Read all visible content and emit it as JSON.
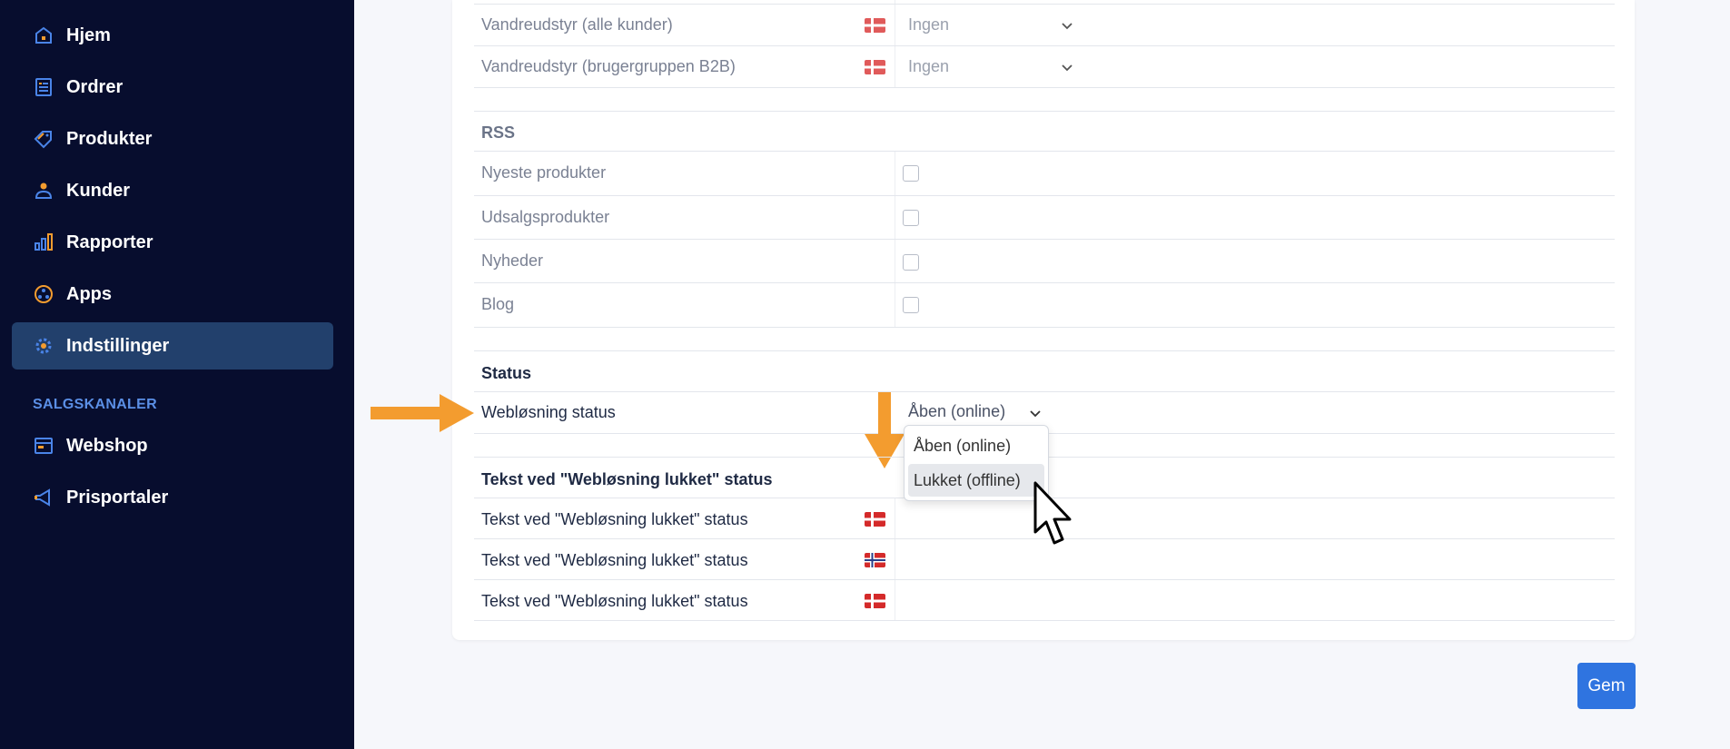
{
  "sidebar": {
    "items": [
      {
        "label": "Hjem",
        "icon": "home-icon"
      },
      {
        "label": "Ordrer",
        "icon": "orders-icon"
      },
      {
        "label": "Produkter",
        "icon": "tag-icon"
      },
      {
        "label": "Kunder",
        "icon": "user-icon"
      },
      {
        "label": "Rapporter",
        "icon": "bar-chart-icon"
      },
      {
        "label": "Apps",
        "icon": "apps-icon"
      },
      {
        "label": "Indstillinger",
        "icon": "gear-icon",
        "active": true
      }
    ],
    "section_label": "SALGSKANALER",
    "channels": [
      {
        "label": "Webshop",
        "icon": "store-icon"
      },
      {
        "label": "Prisportaler",
        "icon": "megaphone-icon"
      }
    ]
  },
  "shipping": {
    "rows": [
      {
        "label": "Vandreudstyr (alle kunder)",
        "value": "Ingen"
      },
      {
        "label": "Vandreudstyr (brugergruppen B2B)",
        "value": "Ingen"
      }
    ]
  },
  "rss": {
    "title": "RSS",
    "rows": [
      {
        "label": "Nyeste produkter"
      },
      {
        "label": "Udsalgsprodukter"
      },
      {
        "label": "Nyheder"
      },
      {
        "label": "Blog"
      }
    ]
  },
  "status": {
    "title": "Status",
    "label": "Webløsning status",
    "value": "Åben (online)",
    "options": [
      "Åben (online)",
      "Lukket (offline)"
    ]
  },
  "closed_text": {
    "title": "Tekst ved \"Webløsning lukket\" status",
    "rows": [
      {
        "label": "Tekst ved \"Webløsning lukket\" status"
      },
      {
        "label": "Tekst ved \"Webløsning lukket\" status"
      },
      {
        "label": "Tekst ved \"Webløsning lukket\" status"
      }
    ]
  },
  "save_label": "Gem",
  "colors": {
    "sidebar_bg": "#070d2e",
    "active_bg": "#22406c",
    "accent_orange": "#f39c2f",
    "primary_blue": "#2f74e0"
  }
}
